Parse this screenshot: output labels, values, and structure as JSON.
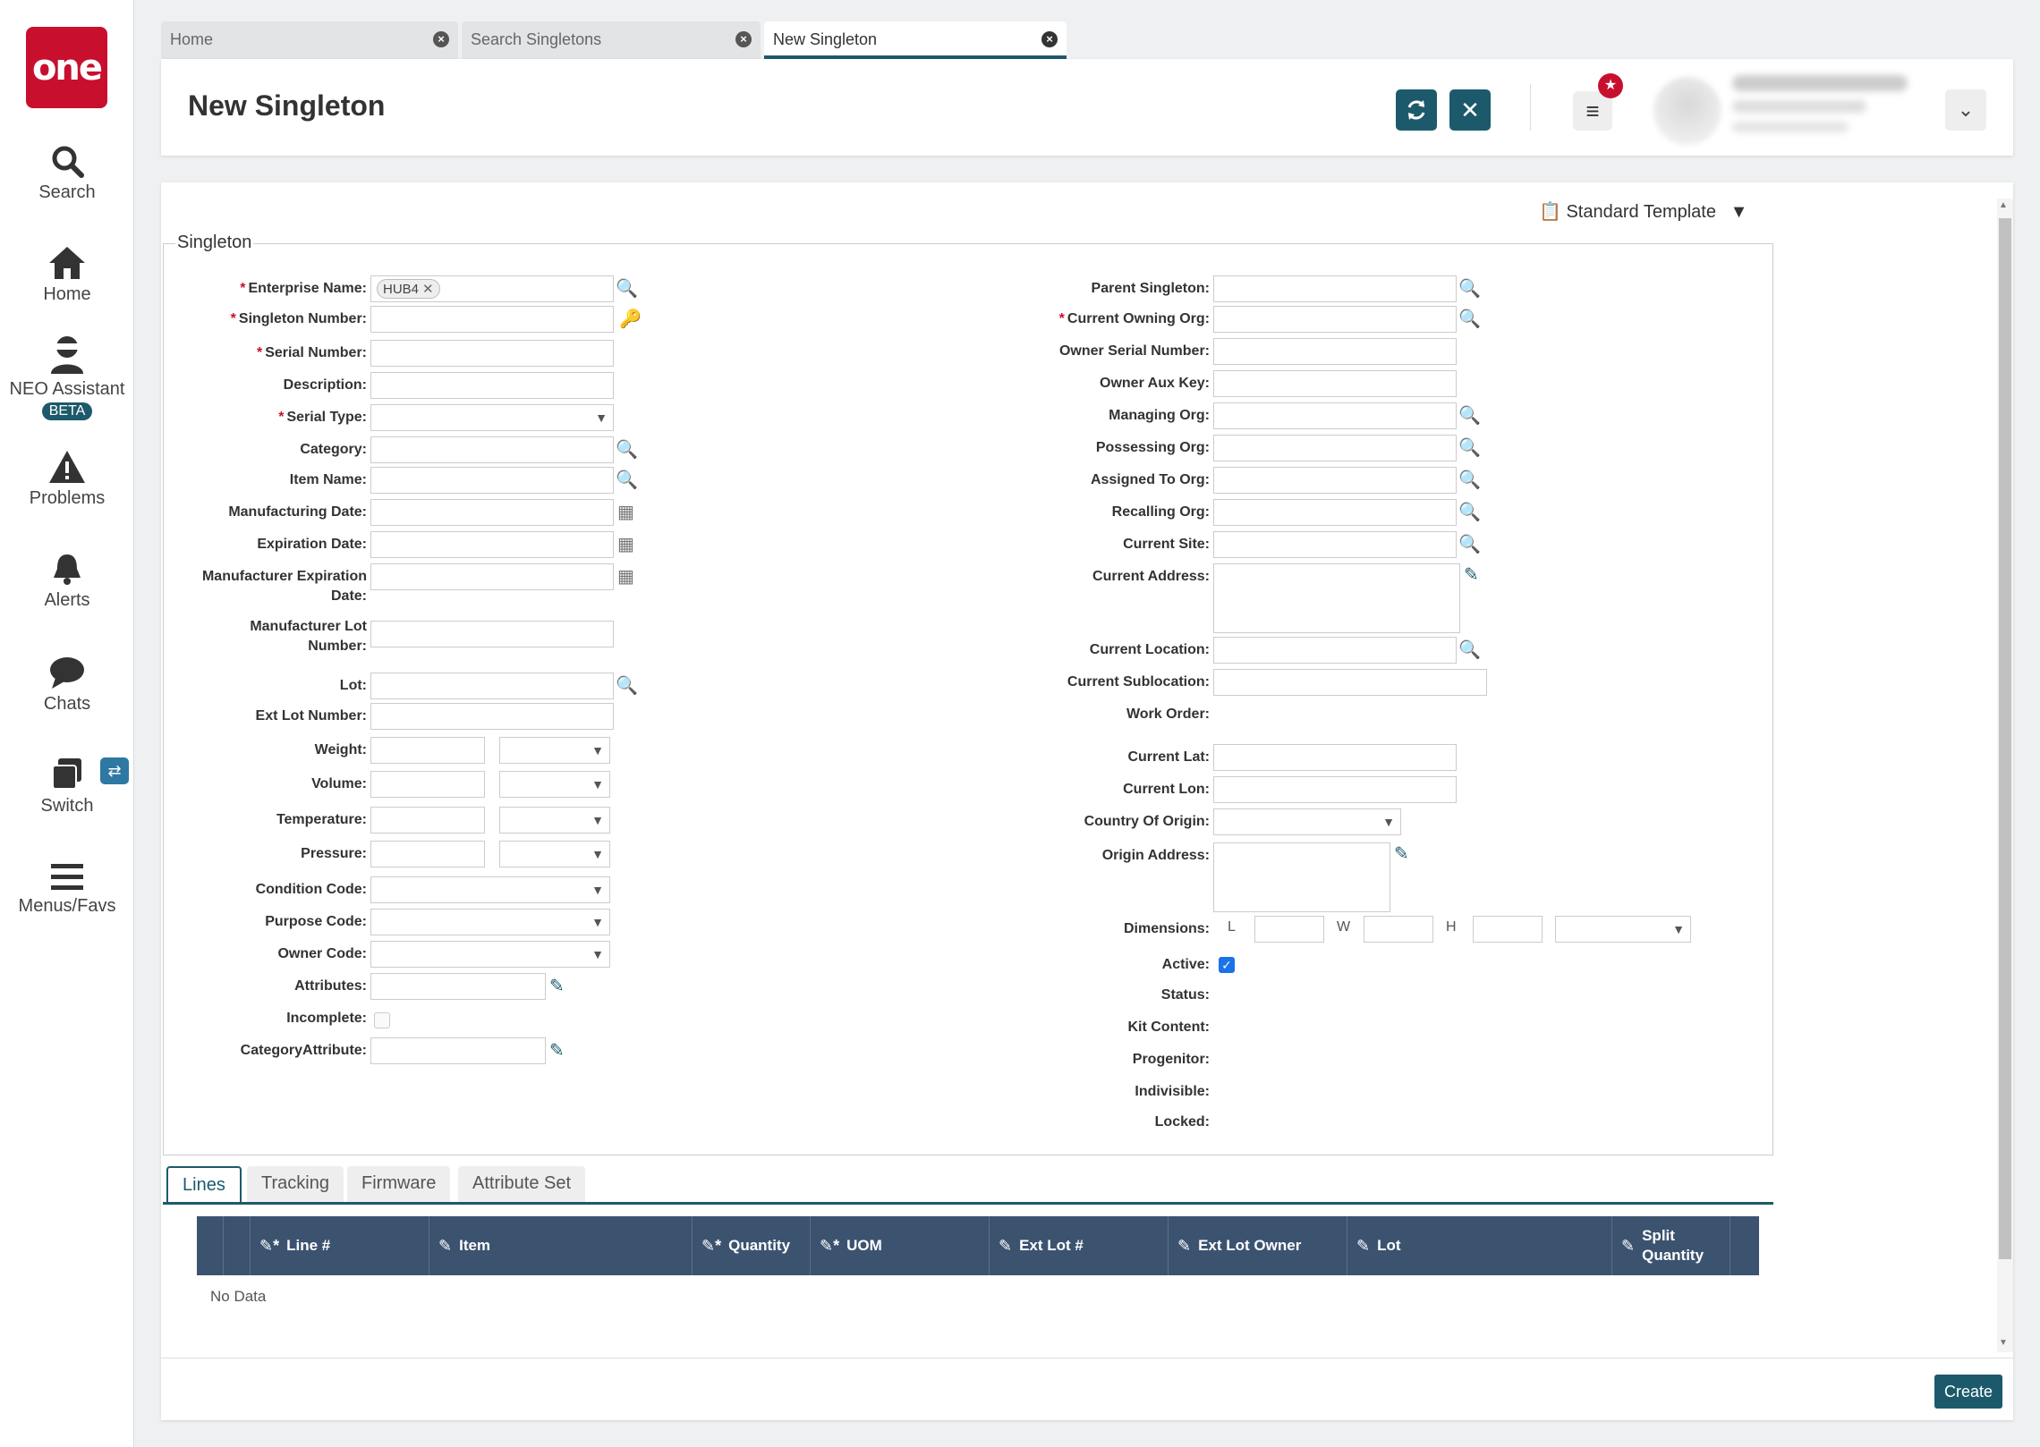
{
  "app": {
    "logo_text": "one"
  },
  "sidebar": {
    "items": [
      {
        "label": "Search",
        "icon": "search-icon"
      },
      {
        "label": "Home",
        "icon": "home-icon"
      },
      {
        "label": "NEO Assistant",
        "icon": "neo-assistant-icon",
        "badge": "BETA"
      },
      {
        "label": "Problems",
        "icon": "warning-icon"
      },
      {
        "label": "Alerts",
        "icon": "bell-icon"
      },
      {
        "label": "Chats",
        "icon": "chat-icon"
      },
      {
        "label": "Switch",
        "icon": "switch-icon"
      },
      {
        "label": "Menus/Favs",
        "icon": "hamburger-icon"
      }
    ]
  },
  "tabs": [
    {
      "label": "Home"
    },
    {
      "label": "Search Singletons"
    },
    {
      "label": "New Singleton",
      "active": true
    }
  ],
  "header": {
    "title": "New Singleton"
  },
  "template": {
    "label": "Standard Template"
  },
  "form": {
    "legend": "Singleton",
    "left": {
      "enterprise_name": {
        "label": "Enterprise Name:",
        "value": "HUB4"
      },
      "singleton_number": {
        "label": "Singleton Number:"
      },
      "serial_number": {
        "label": "Serial Number:"
      },
      "description": {
        "label": "Description:"
      },
      "serial_type": {
        "label": "Serial Type:"
      },
      "category": {
        "label": "Category:"
      },
      "item_name": {
        "label": "Item Name:"
      },
      "manufacturing_date": {
        "label": "Manufacturing Date:"
      },
      "expiration_date": {
        "label": "Expiration Date:"
      },
      "manufacturer_expiration_date": {
        "label1": "Manufacturer Expiration",
        "label2": "Date:"
      },
      "manufacturer_lot_number": {
        "label1": "Manufacturer Lot",
        "label2": "Number:"
      },
      "lot": {
        "label": "Lot:"
      },
      "ext_lot_number": {
        "label": "Ext Lot Number:"
      },
      "weight": {
        "label": "Weight:"
      },
      "volume": {
        "label": "Volume:"
      },
      "temperature": {
        "label": "Temperature:"
      },
      "pressure": {
        "label": "Pressure:"
      },
      "condition_code": {
        "label": "Condition Code:"
      },
      "purpose_code": {
        "label": "Purpose Code:"
      },
      "owner_code": {
        "label": "Owner Code:"
      },
      "attributes": {
        "label": "Attributes:"
      },
      "incomplete": {
        "label": "Incomplete:",
        "checked": false
      },
      "category_attribute": {
        "label": "CategoryAttribute:"
      }
    },
    "right": {
      "parent_singleton": {
        "label": "Parent Singleton:"
      },
      "current_owning_org": {
        "label": "Current Owning Org:"
      },
      "owner_serial_number": {
        "label": "Owner Serial Number:"
      },
      "owner_aux_key": {
        "label": "Owner Aux Key:"
      },
      "managing_org": {
        "label": "Managing Org:"
      },
      "possessing_org": {
        "label": "Possessing Org:"
      },
      "assigned_to_org": {
        "label": "Assigned To Org:"
      },
      "recalling_org": {
        "label": "Recalling Org:"
      },
      "current_site": {
        "label": "Current Site:"
      },
      "current_address": {
        "label": "Current Address:"
      },
      "current_location": {
        "label": "Current Location:"
      },
      "current_sublocation": {
        "label": "Current Sublocation:"
      },
      "work_order": {
        "label": "Work Order:"
      },
      "current_lat": {
        "label": "Current Lat:"
      },
      "current_lon": {
        "label": "Current Lon:"
      },
      "country_of_origin": {
        "label": "Country Of Origin:"
      },
      "origin_address": {
        "label": "Origin Address:"
      },
      "dimensions": {
        "label": "Dimensions:",
        "l": "L",
        "w": "W",
        "h": "H"
      },
      "active": {
        "label": "Active:",
        "checked": true
      },
      "status": {
        "label": "Status:"
      },
      "kit_content": {
        "label": "Kit Content:"
      },
      "progenitor": {
        "label": "Progenitor:"
      },
      "indivisible": {
        "label": "Indivisible:"
      },
      "locked": {
        "label": "Locked:"
      }
    }
  },
  "bottom_tabs": [
    {
      "label": "Lines",
      "active": true
    },
    {
      "label": "Tracking"
    },
    {
      "label": "Firmware"
    },
    {
      "label": "Attribute Set"
    }
  ],
  "grid": {
    "columns": [
      "Line #",
      "Item",
      "Quantity",
      "UOM",
      "Ext Lot #",
      "Ext Lot Owner",
      "Lot",
      "Split",
      "Quantity"
    ],
    "empty_text": "No Data"
  },
  "footer": {
    "create_label": "Create"
  },
  "colors": {
    "brand": "#c8102e",
    "primary": "#1c5a6b",
    "grid_header": "#3c5370"
  }
}
